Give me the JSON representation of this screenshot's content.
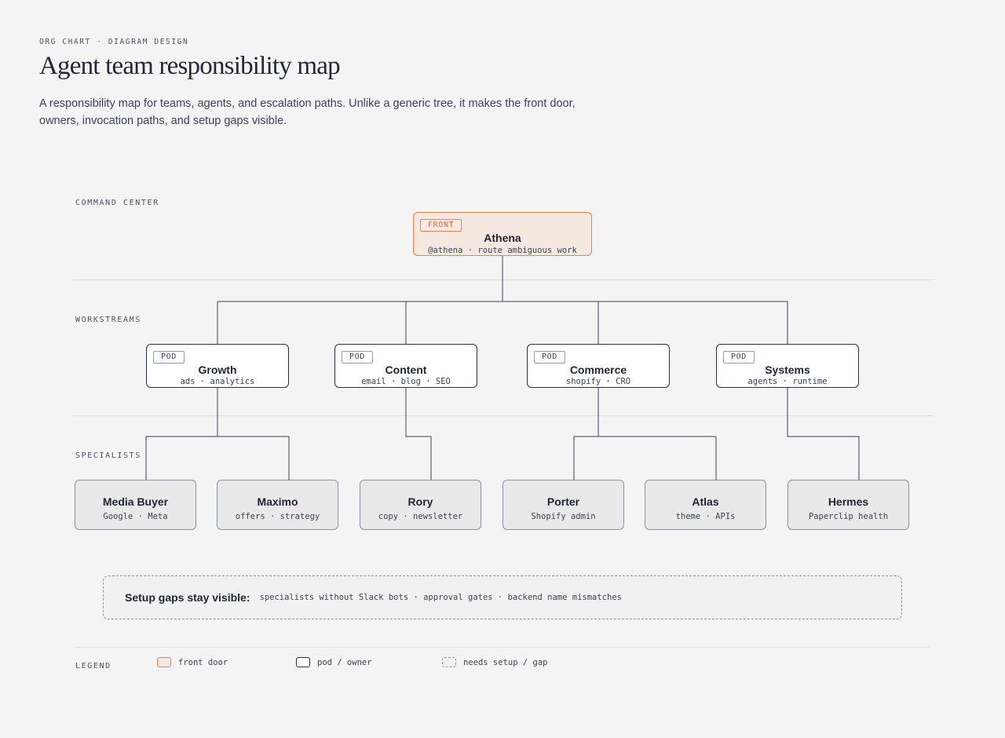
{
  "header": {
    "eyebrow": "ORG CHART · DIAGRAM DESIGN",
    "title": "Agent team responsibility map",
    "description": "A responsibility map for teams, agents, and escalation paths. Unlike a generic tree, it makes the front door, owners, invocation paths, and setup gaps visible."
  },
  "sections": {
    "command": "COMMAND CENTER",
    "workstreams": "WORKSTREAMS",
    "specialists": "SPECIALISTS"
  },
  "front_door": {
    "tag": "FRONT",
    "name": "Athena",
    "sub": "@athena · route ambiguous work"
  },
  "pods": [
    {
      "tag": "POD",
      "name": "Growth",
      "sub": "ads · analytics"
    },
    {
      "tag": "POD",
      "name": "Content",
      "sub": "email · blog · SEO"
    },
    {
      "tag": "POD",
      "name": "Commerce",
      "sub": "shopify · CRO"
    },
    {
      "tag": "POD",
      "name": "Systems",
      "sub": "agents · runtime"
    }
  ],
  "specialists": [
    {
      "name": "Media Buyer",
      "sub": "Google · Meta"
    },
    {
      "name": "Maximo",
      "sub": "offers · strategy"
    },
    {
      "name": "Rory",
      "sub": "copy · newsletter"
    },
    {
      "name": "Porter",
      "sub": "Shopify admin"
    },
    {
      "name": "Atlas",
      "sub": "theme · APIs"
    },
    {
      "name": "Hermes",
      "sub": "Paperclip health"
    }
  ],
  "setup_gaps": {
    "lead": "Setup gaps stay visible:",
    "items": "specialists without Slack bots · approval gates · backend name mismatches"
  },
  "legend": {
    "title": "LEGEND",
    "items": [
      {
        "label": "front door"
      },
      {
        "label": "pod / owner"
      },
      {
        "label": "needs setup / gap"
      }
    ]
  },
  "colors": {
    "front_accent": "#e8824f",
    "front_fill": "#f5e8e1",
    "connector": "#3a4055",
    "background": "#f4f4f4"
  }
}
